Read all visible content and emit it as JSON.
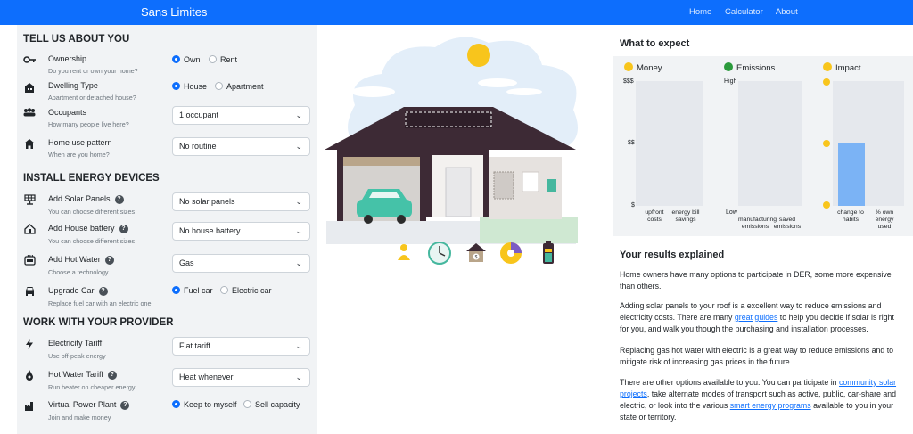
{
  "app": {
    "brand": "Sans Limites",
    "nav": [
      "Home",
      "Calculator",
      "About"
    ]
  },
  "left": {
    "section1": "TELL US ABOUT YOU",
    "ownership": {
      "label": "Ownership",
      "sub": "Do you rent or own your home?",
      "opt1": "Own",
      "opt2": "Rent",
      "selected": "Own"
    },
    "dwelling": {
      "label": "Dwelling Type",
      "sub": "Apartment or detached house?",
      "opt1": "House",
      "opt2": "Apartment",
      "selected": "House"
    },
    "occupants": {
      "label": "Occupants",
      "sub": "How many people live here?",
      "value": "1 occupant"
    },
    "pattern": {
      "label": "Home use pattern",
      "sub": "When are you home?",
      "value": "No routine"
    },
    "section2": "INSTALL ENERGY DEVICES",
    "solar": {
      "label": "Add Solar Panels",
      "sub": "You can choose different sizes",
      "value": "No solar panels"
    },
    "battery": {
      "label": "Add House battery",
      "sub": "You can choose different sizes",
      "value": "No house battery"
    },
    "hotwater": {
      "label": "Add Hot Water",
      "sub": "Choose a technology",
      "value": "Gas"
    },
    "car": {
      "label": "Upgrade Car",
      "sub": "Replace fuel car with an electric one",
      "opt1": "Fuel car",
      "opt2": "Electric car",
      "selected": "Fuel car"
    },
    "section3": "WORK WITH YOUR PROVIDER",
    "tariff": {
      "label": "Electricity Tariff",
      "sub": "Use off-peak energy",
      "value": "Flat tariff"
    },
    "hwtariff": {
      "label": "Hot Water Tariff",
      "sub": "Run heater on cheaper energy",
      "value": "Heat whenever"
    },
    "vpp": {
      "label": "Virtual Power Plant",
      "sub": "Join and make money",
      "opt1": "Keep to myself",
      "opt2": "Sell capacity",
      "selected": "Keep to myself"
    }
  },
  "right": {
    "expect_title": "What to expect",
    "money": {
      "title": "Money",
      "ticks": [
        "$$$",
        "$$",
        "$"
      ],
      "x1": "upfront costs",
      "x2": "energy bill savings"
    },
    "emissions": {
      "title": "Emissions",
      "ticks": [
        "High",
        "Low"
      ],
      "x1": "manufacturing emissions",
      "x2": "saved emissions"
    },
    "impact": {
      "title": "Impact",
      "x1": "change to habits",
      "x2": "% own energy used"
    },
    "explained_title": "Your results explained",
    "p1": "Home owners have many options to participate in DER, some more expensive than others.",
    "p2a": "Adding solar panels to your roof is a excellent way to reduce emissions and electricity costs. There are many ",
    "p2link1": "great",
    "p2link2": "guides",
    "p2b": " to help you decide if solar is right for you, and walk you though the purchasing and installation processes.",
    "p3": "Replacing gas hot water with electric is a great way to reduce emissions and to mitigate risk of increasing gas prices in the future.",
    "p4a": "There are other options available to you. You can participate in ",
    "p4link1": "community solar projects",
    "p4b": ", take alternate modes of transport such as active, public, car-share and electric, or look into the various ",
    "p4link2": "smart energy programs",
    "p4c": " available to you in your state or territory."
  },
  "chart_data": [
    {
      "type": "bar",
      "title": "Money",
      "categories": [
        "upfront costs",
        "energy bill savings"
      ],
      "values": [
        0,
        0
      ],
      "yticks": [
        "$",
        "$$",
        "$$$"
      ]
    },
    {
      "type": "bar",
      "title": "Emissions",
      "categories": [
        "manufacturing emissions",
        "saved emissions"
      ],
      "values": [
        0,
        0
      ],
      "yticks": [
        "Low",
        "High"
      ]
    },
    {
      "type": "bar",
      "title": "Impact",
      "categories": [
        "change to habits",
        "% own energy used"
      ],
      "values": [
        0.5,
        0
      ],
      "ylim": [
        0,
        1
      ]
    }
  ],
  "colors": {
    "primary": "#0d6efd",
    "panel": "#f1f3f5",
    "bar": "#7bb3f5",
    "roof": "#3d2a35"
  }
}
